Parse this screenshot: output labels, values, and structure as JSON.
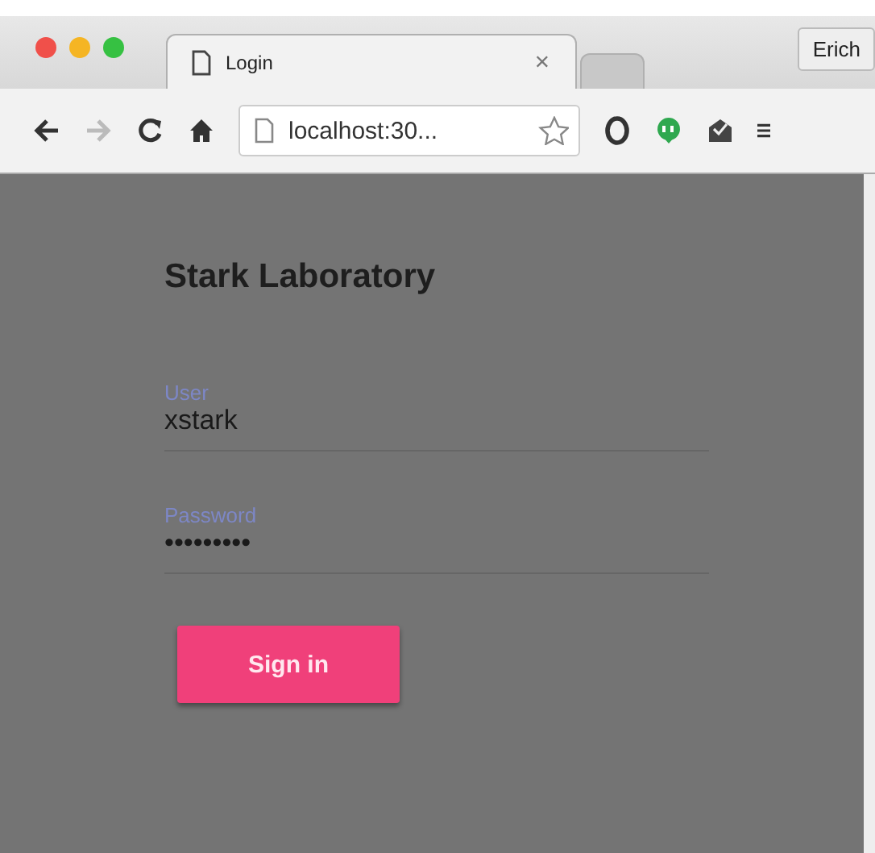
{
  "browser": {
    "tabs": [
      {
        "title": "Login",
        "selected": true
      },
      {
        "selected": false
      }
    ],
    "profile": "Erich",
    "address": "localhost:30..."
  },
  "page": {
    "title": "Stark Laboratory",
    "fields": [
      {
        "label": "User",
        "value": "xstark"
      },
      {
        "label": "Password",
        "value": "•••••••••"
      }
    ],
    "button": "Sign in"
  }
}
